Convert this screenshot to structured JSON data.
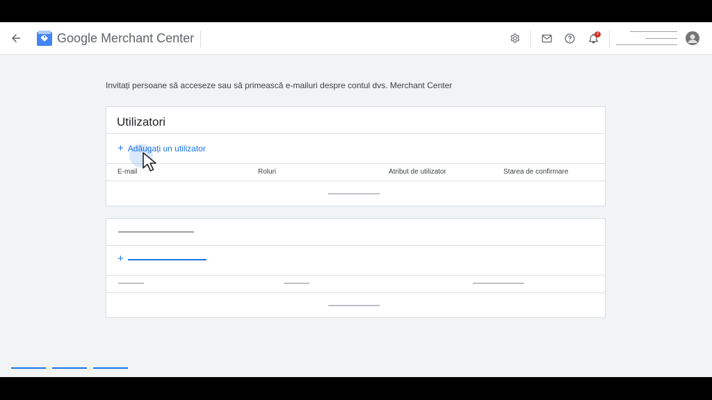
{
  "header": {
    "brand_google": "Google",
    "brand_product": "Merchant Center",
    "notification_count": "2",
    "icons": [
      "back-arrow-icon",
      "merchant-center-logo-icon",
      "gear-icon",
      "mail-icon",
      "help-icon",
      "bell-icon",
      "account-avatar-icon"
    ]
  },
  "intro_text": "Invitați persoane să acceseze sau să primească e-mailuri despre contul dvs. Merchant Center",
  "users_card": {
    "title": "Utilizatori",
    "add_label": "Adăugați un utilizator",
    "add_icon": "+",
    "columns": [
      "E-mail",
      "Roluri",
      "Atribut de utilizator",
      "Starea de confirmare"
    ]
  },
  "second_card": {
    "add_icon": "+"
  },
  "colors": {
    "accent": "#1a73e8",
    "badge": "#d93025",
    "background": "#f1f3f4"
  }
}
